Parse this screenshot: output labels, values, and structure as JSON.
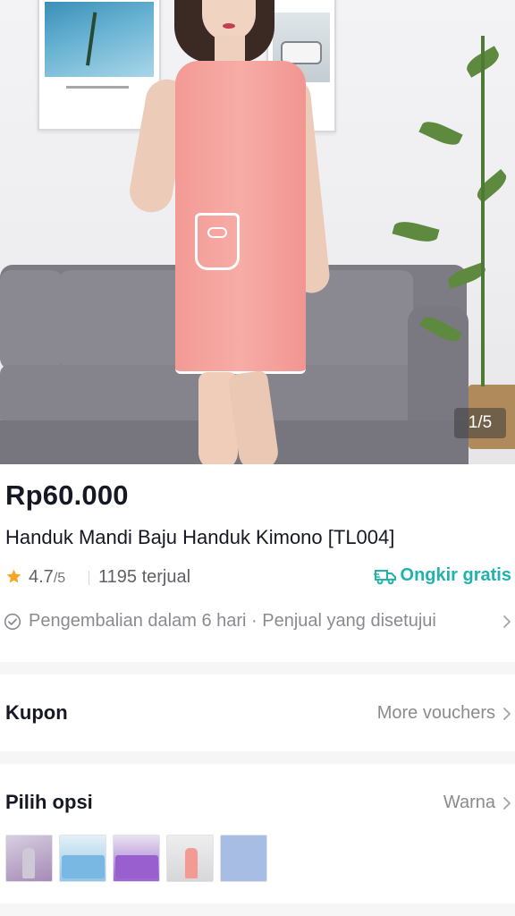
{
  "gallery": {
    "counter": "1/5",
    "image_alt": "Model wearing pink towel dress in living room"
  },
  "product": {
    "price": "Rp60.000",
    "title": "Handuk Mandi Baju Handuk Kimono [TL004]",
    "rating": "4.7",
    "rating_max": "/5",
    "sold": "1195 terjual",
    "shipping": "Ongkir gratis",
    "returns": "Pengembalian dalam 6 hari · Penjual yang disetujui"
  },
  "coupon": {
    "label": "Kupon",
    "action": "More vouchers"
  },
  "options": {
    "label": "Pilih opsi",
    "action": "Warna",
    "variants": [
      "grey",
      "blue",
      "purple",
      "pink",
      "light-blue"
    ]
  },
  "colors": {
    "accent_teal": "#20b2ac",
    "star": "#f5a623",
    "text_primary": "#161823",
    "text_secondary": "#8a8b91"
  },
  "icons": {
    "star": "star-icon",
    "truck": "truck-icon",
    "check": "check-circle-icon",
    "chevron": "chevron-right-icon"
  }
}
